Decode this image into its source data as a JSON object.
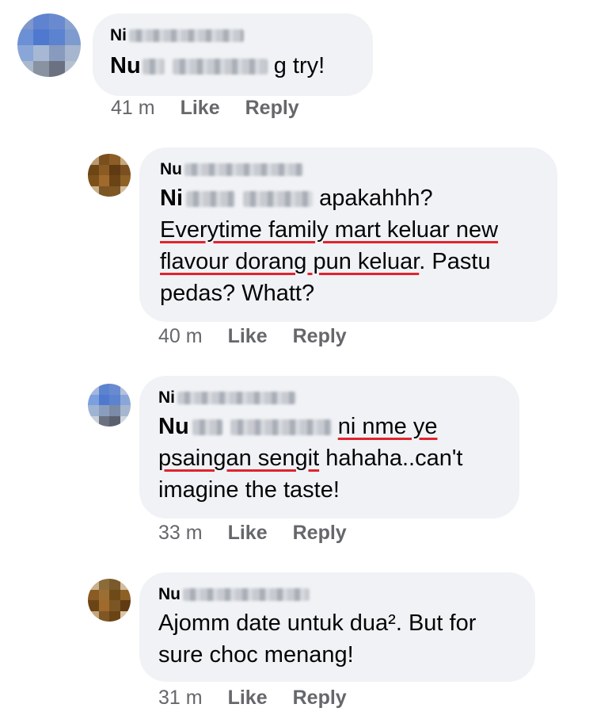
{
  "comments": [
    {
      "author_visible": "Ni",
      "mention_visible": "Nu",
      "text_before": "",
      "text_after": "g try!",
      "time": "41 m",
      "like": "Like",
      "reply": "Reply"
    },
    {
      "author_visible": "Nu",
      "mention_visible": "Ni",
      "text_after": "apakahhh?",
      "underlined": "Everytime family mart keluar new flavour dorang pun keluar",
      "text_end": ". Pastu pedas? Whatt?",
      "time": "40 m",
      "like": "Like",
      "reply": "Reply"
    },
    {
      "author_visible": "Ni",
      "mention_visible": "Nu",
      "underlined": "ni nme ye psaingan sengit",
      "text_end": " hahaha..can't imagine the taste!",
      "time": "33 m",
      "like": "Like",
      "reply": "Reply"
    },
    {
      "author_visible": "Nu",
      "text": "Ajomm date untuk dua². But for sure choc menang!",
      "time": "31 m",
      "like": "Like",
      "reply": "Reply"
    }
  ],
  "colors": {
    "bubble": "#f0f2f5",
    "meta_text": "#65676b",
    "underline": "#e0242e"
  }
}
